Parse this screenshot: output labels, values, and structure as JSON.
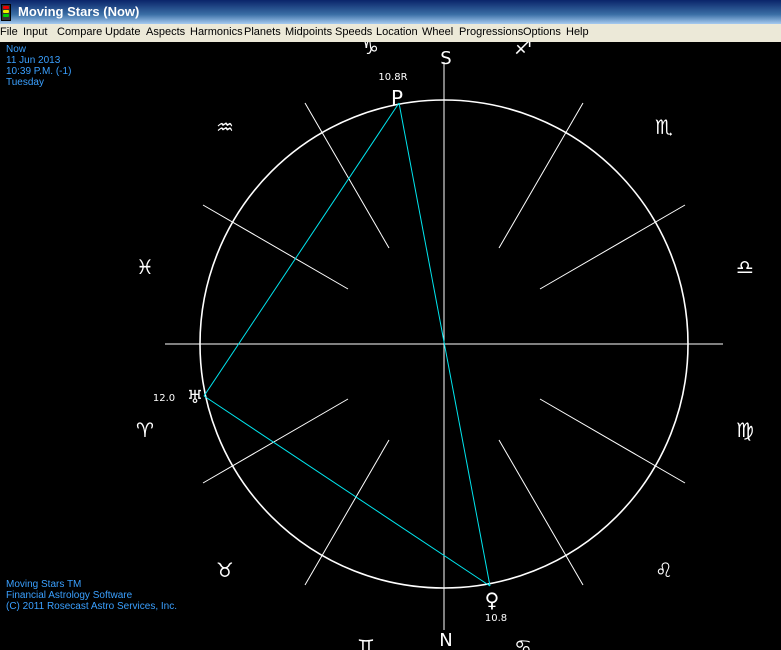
{
  "window": {
    "title": "Moving Stars (Now)"
  },
  "menu": [
    "File",
    "Input",
    "Compare",
    "Update",
    "Aspects",
    "Harmonics",
    "Planets",
    "Midpoints",
    "Speeds",
    "Location",
    "Wheel",
    "Progressions",
    "Options",
    "Help"
  ],
  "info_top": [
    "Now",
    "11 Jun 2013",
    "10:39 P.M. (-1)",
    "Tuesday"
  ],
  "info_bottom": [
    "Moving Stars TM",
    "Financial Astrology Software",
    "(C) 2011 Rosecast Astro Services, Inc."
  ],
  "wheel": {
    "axis_top_label": "S",
    "axis_bottom_label": "N",
    "signs": [
      {
        "name": "capricorn-sign",
        "glyph": "♑"
      },
      {
        "name": "sagittarius-sign",
        "glyph": "♐"
      },
      {
        "name": "scorpio-sign",
        "glyph": "♏"
      },
      {
        "name": "libra-sign",
        "glyph": "♎"
      },
      {
        "name": "virgo-sign",
        "glyph": "♍"
      },
      {
        "name": "leo-sign",
        "glyph": "♌"
      },
      {
        "name": "cancer-sign",
        "glyph": "♋"
      },
      {
        "name": "gemini-sign",
        "glyph": "♊"
      },
      {
        "name": "taurus-sign",
        "glyph": "♉"
      },
      {
        "name": "aries-sign",
        "glyph": "♈"
      },
      {
        "name": "pisces-sign",
        "glyph": "♓"
      },
      {
        "name": "aquarius-sign",
        "glyph": "♒"
      }
    ],
    "planets": [
      {
        "name": "pluto",
        "glyph": "P",
        "value": "10.8R"
      },
      {
        "name": "uranus",
        "glyph": "♅",
        "value": "12.0"
      },
      {
        "name": "venus",
        "glyph": "♀",
        "value": "10.8"
      }
    ],
    "colors": {
      "circle": "#ffffff",
      "aspect": "#00e5ee",
      "info_text": "#3aa0ff",
      "axis": "#ffffff"
    }
  }
}
